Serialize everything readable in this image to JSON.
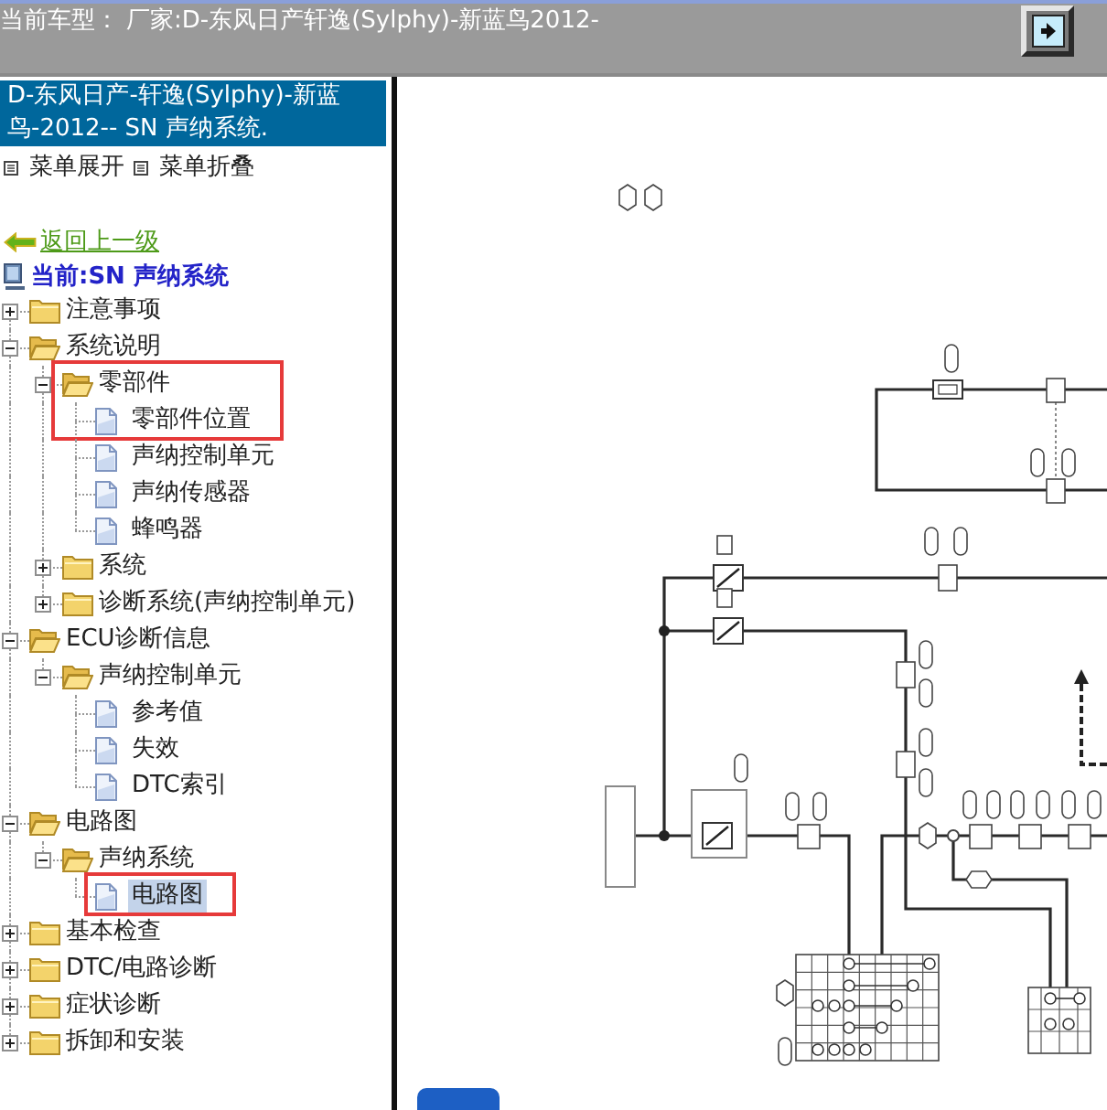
{
  "top_bar": {
    "label": "当前车型：",
    "model": "厂家:D-东风日产轩逸(Sylphy)-新蓝鸟2012-"
  },
  "sidebar": {
    "header": "D-东风日产-轩逸(Sylphy)-新蓝鸟-2012-- SN 声纳系统.",
    "menu_links": [
      "菜单展开",
      "菜单折叠"
    ],
    "back_link": "返回上一级",
    "current": "当前:SN 声纳系统"
  },
  "tree": [
    {
      "label": "注意事项",
      "kind": "folder",
      "expanded": false,
      "selected": false,
      "highlighted": false
    },
    {
      "label": "系统说明",
      "kind": "folder",
      "expanded": true,
      "selected": false,
      "highlighted": false,
      "children": [
        {
          "label": "零部件",
          "kind": "folder",
          "expanded": true,
          "selected": false,
          "highlighted": true,
          "children": [
            {
              "label": "零部件位置",
              "kind": "page",
              "selected": false,
              "highlighted": true
            },
            {
              "label": "声纳控制单元",
              "kind": "page",
              "selected": false,
              "highlighted": false
            },
            {
              "label": "声纳传感器",
              "kind": "page",
              "selected": false,
              "highlighted": false
            },
            {
              "label": "蜂鸣器",
              "kind": "page",
              "selected": false,
              "highlighted": false
            }
          ]
        },
        {
          "label": "系统",
          "kind": "folder",
          "expanded": false,
          "selected": false,
          "highlighted": false
        },
        {
          "label": "诊断系统(声纳控制单元)",
          "kind": "folder",
          "expanded": false,
          "selected": false,
          "highlighted": false
        }
      ]
    },
    {
      "label": "ECU诊断信息",
      "kind": "folder",
      "expanded": true,
      "selected": false,
      "highlighted": false,
      "children": [
        {
          "label": "声纳控制单元",
          "kind": "folder",
          "expanded": true,
          "selected": false,
          "highlighted": false,
          "children": [
            {
              "label": "参考值",
              "kind": "page",
              "selected": false,
              "highlighted": false
            },
            {
              "label": "失效",
              "kind": "page",
              "selected": false,
              "highlighted": false
            },
            {
              "label": "DTC索引",
              "kind": "page",
              "selected": false,
              "highlighted": false
            }
          ]
        }
      ]
    },
    {
      "label": "电路图",
      "kind": "folder",
      "expanded": true,
      "selected": false,
      "highlighted": false,
      "children": [
        {
          "label": "声纳系统",
          "kind": "folder",
          "expanded": true,
          "selected": false,
          "highlighted": false,
          "children": [
            {
              "label": "电路图",
              "kind": "page",
              "selected": true,
              "highlighted": true
            }
          ]
        }
      ]
    },
    {
      "label": "基本检查",
      "kind": "folder",
      "expanded": false,
      "selected": false,
      "highlighted": false
    },
    {
      "label": "DTC/电路诊断",
      "kind": "folder",
      "expanded": false,
      "selected": false,
      "highlighted": false
    },
    {
      "label": "症状诊断",
      "kind": "folder",
      "expanded": false,
      "selected": false,
      "highlighted": false
    },
    {
      "label": "拆卸和安装",
      "kind": "folder",
      "expanded": false,
      "selected": false,
      "highlighted": false
    }
  ]
}
